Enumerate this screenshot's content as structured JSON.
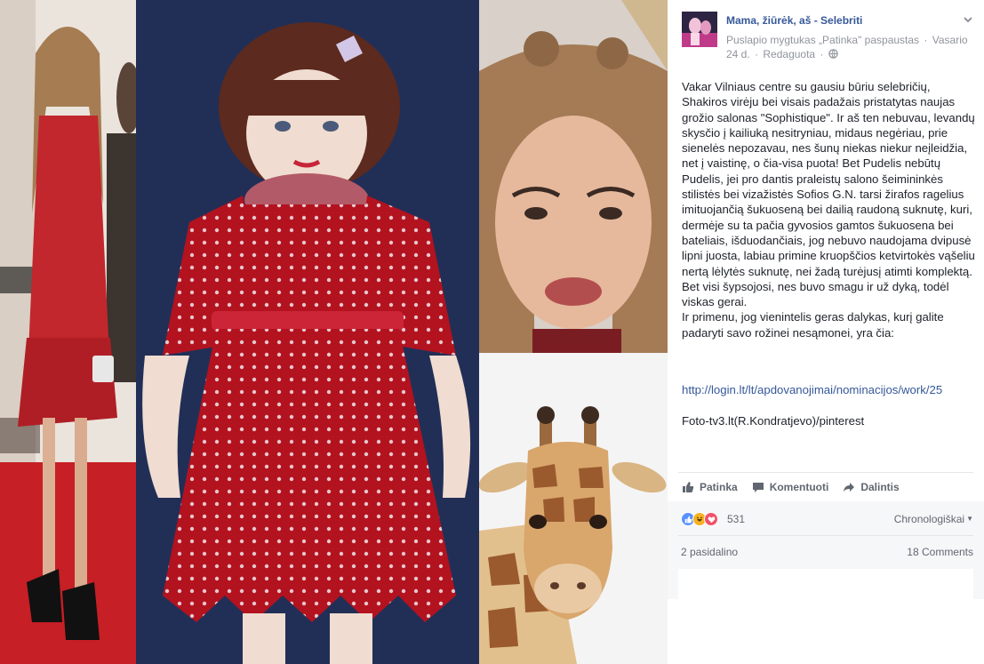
{
  "post": {
    "page_name": "Mama, žiūrėk, aš - Selebriti",
    "meta_line": "Puslapio mygtukas „Patinka\" paspaustas",
    "date": "Vasario 24 d.",
    "meta_separator": "·",
    "edited": "Redaguota",
    "text": "Vakar Vilniaus centre su gausiu būriu selebričių, Shakiros virėju bei visais padažais pristatytas naujas grožio salonas \"Sophistique\". Ir aš ten nebuvau, levandų skysčio į kailiuką nesitryniau, midaus negėriau, prie sienelės nepozavau, nes šunų niekas niekur neįleidžia, net į vaistinę, o čia-visa puota! Bet Pudelis nebūtų Pudelis, jei pro dantis praleistų salono šeimininkės stilistės bei vizažistės Sofios G.N. tarsi žirafos ragelius imituojančią šukuoseną bei dailią raudoną suknutę, kuri, dermėje su ta pačia gyvosios gamtos šukuosena bei bateliais, išduodančiais, jog nebuvo naudojama dvipusė lipni juosta, labiau primine kruopščios ketvirtokės vąšeliu nertą lėlytės suknutę, nei žadą turėjusį atimti komplektą.\nBet visi šypsojosi, nes buvo smagu ir už dyką, todėl viskas gerai.\nIr primenu, jog vienintelis geras dalykas, kurį galite padaryti savo rožinei nesąmonei, yra čia:",
    "link": "http://login.lt/lt/apdovanojimai/nominacijos/work/25",
    "credit": "Foto-tv3.lt(R.Kondratjevo)/pinterest"
  },
  "actions": {
    "like": "Patinka",
    "comment": "Komentuoti",
    "share": "Dalintis"
  },
  "reactions": {
    "count": "531",
    "types": [
      "like",
      "haha",
      "love"
    ],
    "sort_label": "Chronologiškai",
    "shares": "2 pasidalino",
    "comments": "18 Comments"
  },
  "colors": {
    "link": "#365899",
    "like_blue": "#5890ff",
    "haha_yellow": "#f7b125",
    "love_red": "#f25268",
    "doll_dress": "#b3121f",
    "doll_background": "#24335c"
  }
}
